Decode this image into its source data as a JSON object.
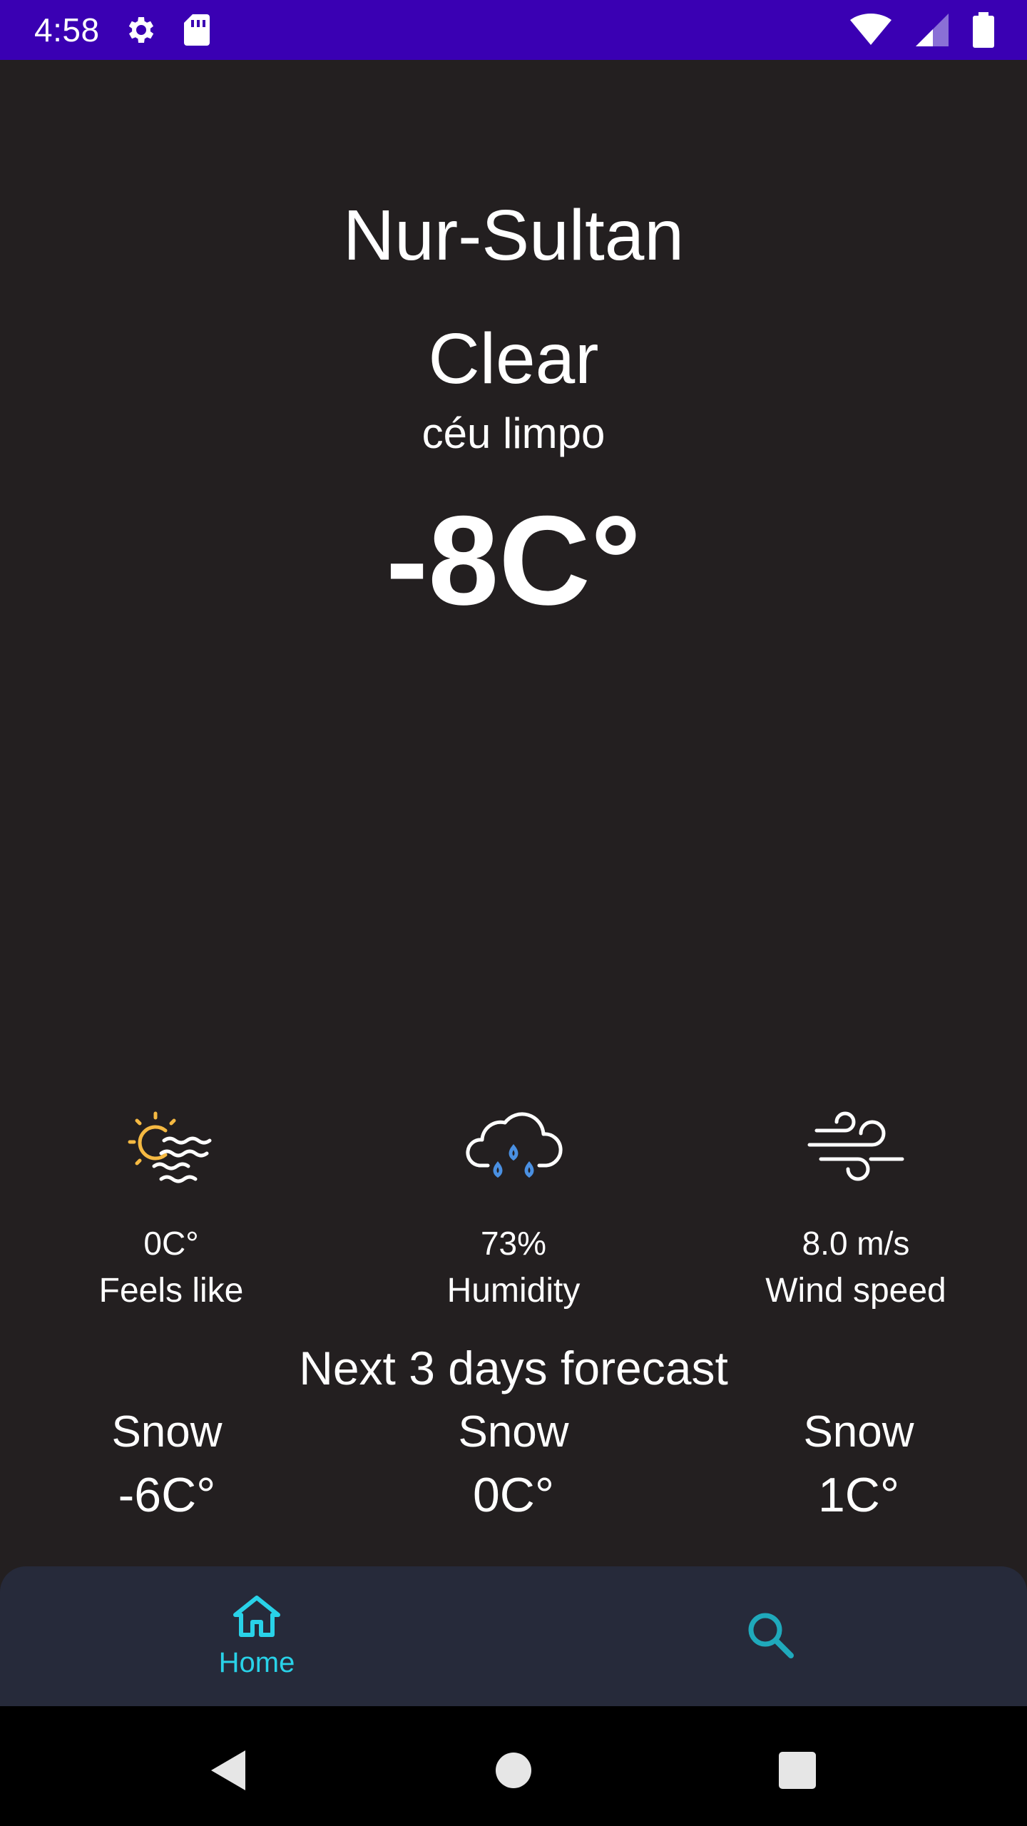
{
  "status_bar": {
    "time": "4:58",
    "background": "#3a00b3",
    "left_icons": [
      "gear-icon",
      "sd-card-icon"
    ],
    "right_icons": [
      "wifi-icon",
      "cellular-signal-icon",
      "battery-icon"
    ]
  },
  "weather": {
    "city": "Nur-Sultan",
    "condition": "Clear",
    "description": "céu limpo",
    "temperature": "-8C°"
  },
  "metrics": [
    {
      "icon": "sun-haze-icon",
      "value": "0C°",
      "label": "Feels like"
    },
    {
      "icon": "rain-cloud-icon",
      "value": "73%",
      "label": "Humidity"
    },
    {
      "icon": "wind-icon",
      "value": "8.0 m/s",
      "label": "Wind speed"
    }
  ],
  "forecast": {
    "title": "Next 3 days forecast",
    "days": [
      {
        "condition": "Snow",
        "temp": "-6C°"
      },
      {
        "condition": "Snow",
        "temp": "0C°"
      },
      {
        "condition": "Snow",
        "temp": "1C°"
      }
    ]
  },
  "bottom_nav": {
    "items": [
      {
        "label": "Home",
        "icon": "home-icon",
        "active": true
      },
      {
        "label": "",
        "icon": "search-icon",
        "active": false
      }
    ],
    "accent": "#29d2e8",
    "background": "#262a3a"
  },
  "system_nav": {
    "buttons": [
      "back-icon",
      "home-circle-icon",
      "recents-icon"
    ]
  },
  "colors": {
    "background": "#231f20",
    "text": "#ffffff",
    "sun_orange": "#f5b942",
    "rain_blue": "#4a90e2"
  }
}
